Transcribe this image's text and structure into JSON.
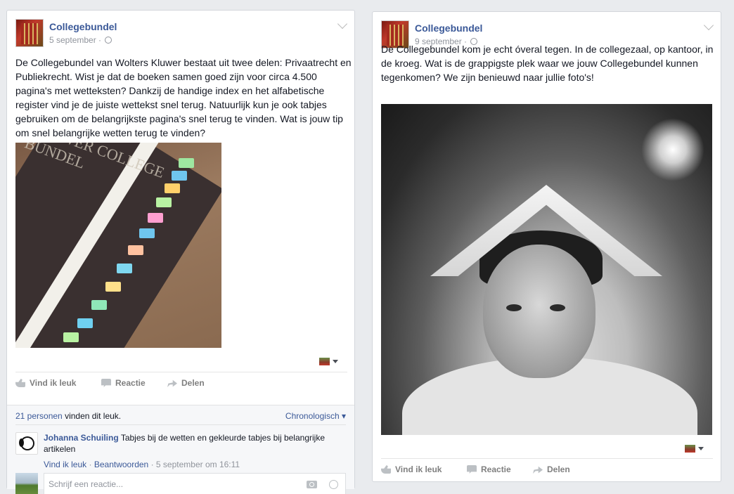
{
  "posts": [
    {
      "author": "Collegebundel",
      "date": "5 september",
      "separator": "·",
      "text": "De Collegebundel van Wolters Kluwer bestaat uit twee delen: Privaatrecht en Publiekrecht. Wist je dat de boeken samen goed zijn voor circa 4.500 pagina's met wetteksten? Dankzij de handige index en het alfabetische register vind je de juiste wettekst snel terug. Natuurlijk kun je ook tabjes gebruiken om de belangrijkste pagina's snel terug te vinden. Wat is jouw tip om snel belangrijke wetten terug te vinden?",
      "photo_caption": "KLUWER COLLEGE BUNDEL",
      "actions": {
        "like": "Vind ik leuk",
        "comment": "Reactie",
        "share": "Delen"
      },
      "likes_count": "21 personen",
      "likes_suffix": "vinden dit leuk.",
      "sort": "Chronologisch",
      "comment": {
        "author": "Johanna Schuiling",
        "text": "Tabjes bij de wetten en gekleurde tabjes bij belangrijke artikelen",
        "like": "Vind ik leuk",
        "reply": "Beantwoorden",
        "time": "5 september om 16:11"
      },
      "reply_placeholder": "Schrijf een reactie..."
    },
    {
      "author": "Collegebundel",
      "date": "9 september",
      "separator": "·",
      "text": "De Collegebundel kom je echt óveral tegen. In de collegezaal, op kantoor, in de kroeg. Wat is de grappigste plek waar we jouw Collegebundel kunnen tegenkomen? We zijn benieuwd naar jullie foto's!",
      "actions": {
        "like": "Vind ik leuk",
        "comment": "Reactie",
        "share": "Delen"
      }
    }
  ],
  "icons": {
    "globe": "globe-icon",
    "chevron": "chevron-down-icon",
    "like": "thumbs-up-icon",
    "comment": "comment-bubble-icon",
    "share": "share-arrow-icon",
    "camera": "camera-icon",
    "emoji": "smiley-icon"
  },
  "colors": {
    "link": "#3b5998",
    "background": "#e9ebee",
    "muted": "#90949c"
  }
}
